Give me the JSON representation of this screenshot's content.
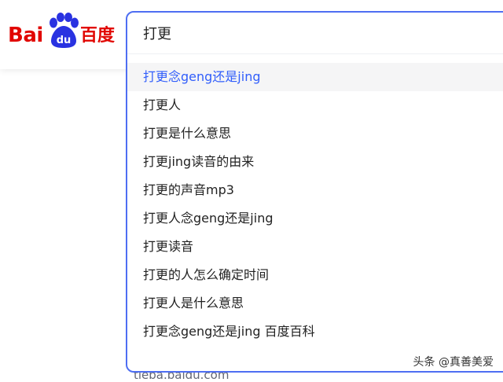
{
  "logo": {
    "latin": "Bai",
    "paw_text": "du",
    "chinese": "百度",
    "brand_color": "#e10601",
    "paw_color": "#2932e1"
  },
  "search": {
    "query": "打更",
    "accent_color": "#4e6ef2"
  },
  "suggestions": [
    "打更念geng还是jing",
    "打更人",
    "打更是什么意思",
    "打更jing读音的由来",
    "打更的声音mp3",
    "打更人念geng还是jing",
    "打更读音",
    "打更的人怎么确定时间",
    "打更人是什么意思",
    "打更念geng还是jing 百度百科"
  ],
  "below_link": "tieba.baidu.com",
  "watermark": "头条 @真善美爱"
}
